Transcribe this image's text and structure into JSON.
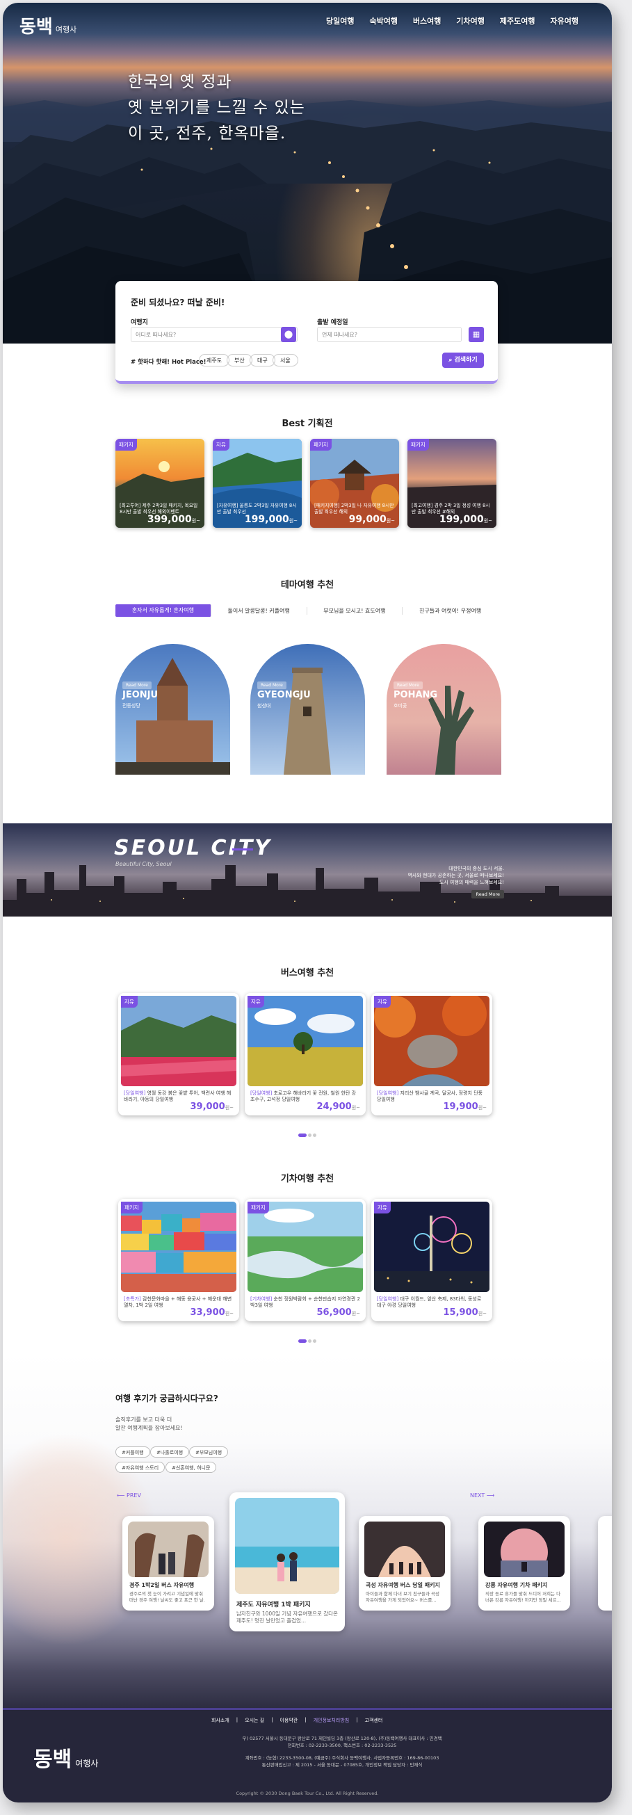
{
  "brand": {
    "name_big": "동백",
    "name_small": "여행사"
  },
  "nav": [
    "당일여행",
    "숙박여행",
    "버스여행",
    "기차여행",
    "제주도여행",
    "자유여행"
  ],
  "hero": {
    "line1": "한국의 옛 정과",
    "line2": "옛 분위기를 느낄 수 있는",
    "line3": "이 곳, 전주, 한옥마을."
  },
  "search": {
    "title": "준비 되셨나요? 떠날 준비!",
    "dest_label": "여행지",
    "dest_placeholder": "어디로 떠나세요?",
    "date_label": "출발 예정일",
    "date_placeholder": "언제 떠나세요?",
    "hot_label": "# 핫하다 핫해! Hot Place!",
    "tags": [
      "제주도",
      "부산",
      "대구",
      "서울"
    ],
    "button": "검색하기"
  },
  "best": {
    "title": "Best 기획전",
    "items": [
      {
        "badge": "패키지",
        "desc": "[최고투어] 제주 2박3일 패키지, 목요일 8시만 출발 최우선 해외이벤트",
        "price": "399,000",
        "unit": "원~"
      },
      {
        "badge": "자유",
        "desc": "[자유여행] 울릉도 2박3일 자유여행 8시만 출발 최우선",
        "price": "199,000",
        "unit": "원~"
      },
      {
        "badge": "패키지",
        "desc": "[패키지여행] 2박3일 나 자유여행 8시만 출발 최우선 해외",
        "price": "99,000",
        "unit": "원~"
      },
      {
        "badge": "패키지",
        "desc": "[최고여행] 경주 2박 3일 정성 여행 8시만 출발 최우선 #해외",
        "price": "199,000",
        "unit": "원~"
      }
    ]
  },
  "theme": {
    "title": "테마여행 추천",
    "tabs": [
      "혼자서 자유롭게! 혼자여행",
      "둘이서 알콩달콩! 커플여행",
      "부모님을 모시고! 효도여행",
      "친구들과 여럿이! 우정여행"
    ],
    "cities": [
      {
        "tag": "Read More",
        "en": "JEONJU",
        "ko": "전동성당"
      },
      {
        "tag": "Read More",
        "en": "GYEONGJU",
        "ko": "첨성대"
      },
      {
        "tag": "Read More",
        "en": "POHANG",
        "ko": "호미곶"
      }
    ]
  },
  "seoul": {
    "title": "SEOUL CITY",
    "subtitle": "Beautiful City, Seoul",
    "desc1": "대한민국의 중심 도시 서울.",
    "desc2": "역사와 현대가 공존하는 곳, 서울로 떠나보세요!",
    "desc3": "도시 여행의 매력을 느껴보세요!",
    "more": "Read More"
  },
  "bus": {
    "title": "버스여행 추천",
    "items": [
      {
        "badge": "자유",
        "tag": "[당일여행]",
        "desc": "영월 동강 붉은 꽃밭 투어, 백련사 여행 해바라기, 야등의 당일여행",
        "price": "39,000",
        "unit": "원~"
      },
      {
        "badge": "자유",
        "tag": "[당일여행]",
        "desc": "초로고우 해바라기 꽃 전원, 철원 한탄 강 조수구, 고석정 당일여행",
        "price": "24,900",
        "unit": "원~"
      },
      {
        "badge": "자유",
        "tag": "[당일여행]",
        "desc": "지리산 뱀사골 계곡, 달궁사, 정령치 단풍 당일여행",
        "price": "19,900",
        "unit": "원~"
      }
    ]
  },
  "train": {
    "title": "기차여행 추천",
    "items": [
      {
        "badge": "패키지",
        "tag": "[초특가]",
        "desc": "감천문화마을 + 해동 용궁사 + 해운대 해변 열차, 1박 2일 여행",
        "price": "33,900",
        "unit": "원~"
      },
      {
        "badge": "패키지",
        "tag": "[기차여행]",
        "desc": "순천 정원박람회 + 순천만습지 자연경관 2박3일 여행",
        "price": "56,900",
        "unit": "원~"
      },
      {
        "badge": "자유",
        "tag": "[당일여행]",
        "desc": "대구 이월드, 앞산 축제, 83타워, 동성로 대구 야경 당일여행",
        "price": "15,900",
        "unit": "원~"
      }
    ]
  },
  "review": {
    "title": "여행 후기가 궁금하시다구요?",
    "sub1": "솔직후기를 보고 더욱 더",
    "sub2": "알찬 여행계획을 잡아보세요!",
    "tags": [
      "#커플여행",
      "#나홀로여행",
      "#부모님여행",
      "#자유여행 스토리",
      "#신혼여행, 허니문"
    ],
    "prev": "PREV",
    "next": "NEXT",
    "cards": [
      {
        "title": "경주 1박2일 버스 자유여행",
        "text": "경주로의 첫 눈이 가려고 기념일에 맞춰 떠난 경주 여행! 날씨도 좋고 포근 한 날."
      },
      {
        "title": "제주도 자유여행 1박 패키지",
        "text": "남자친구와 1000일 기념 자유여행으로 갔다온 제주도! 멋진 날만었고 즐겁었..."
      },
      {
        "title": "곡성 자유여행 버스 당일 패키지",
        "text": "아이들과 함께 다녀 보기 친구들과 곡성 자유여행을 가게 되었어요~ 버스를..."
      },
      {
        "title": "강릉 자유여행 기차 패키지",
        "text": "직장 동료 휴가를 맞춰 드디어 저희는 다녀온 강릉 자유여행! 하지만 정말 세르..."
      }
    ]
  },
  "footer": {
    "nav": [
      "회사소개",
      "오시는 길",
      "이용약관",
      "개인정보처리방침",
      "고객센터"
    ],
    "info1": "우) 02577 서울시 동대문구 왕산로 71 제인빌딩 3층 (왕산로 120-8), (주)동백여행사 대표이사 : 민경백",
    "info2": "전화번호 : 02-2233-3500, 팩스번호 : 02-2233-3525",
    "info3": "계좌번호 : (농협) 2233-3500-08, (예금주) 주식회사 동백여행사, 사업자등록번호 : 169-86-00103",
    "info4": "통신판매업신고 : 제 2015 - 서울 동대문 - 07085호, 개인정보 책임 담당자 : 민재식",
    "copyright": "Copyright © 2030 Dong Baek Tour Co., Ltd. All Right Reserved."
  },
  "colors": {
    "accent": "#7b52e3",
    "footer_bg": "#26263a"
  }
}
